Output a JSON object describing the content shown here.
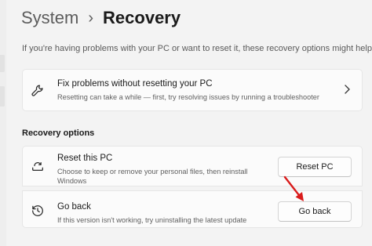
{
  "header": {
    "root": "System",
    "separator": "›",
    "current": "Recovery"
  },
  "intro_text": "If you're having problems with your PC or want to reset it, these recovery options might help.",
  "fix_problems": {
    "title": "Fix problems without resetting your PC",
    "description": "Resetting can take a while — first, try resolving issues by running a troubleshooter",
    "icon": "wrench-icon"
  },
  "recovery_options": {
    "heading": "Recovery options",
    "reset": {
      "title": "Reset this PC",
      "description": "Choose to keep or remove your personal files, then reinstall Windows",
      "button": "Reset PC",
      "icon": "reset-pc-icon"
    },
    "go_back": {
      "title": "Go back",
      "description": "If this version isn't working, try uninstalling the latest update",
      "button": "Go back",
      "icon": "history-icon"
    }
  },
  "colors": {
    "background": "#f3f3f3",
    "card": "#fbfbfb",
    "annotation_arrow": "#d91b1b"
  }
}
